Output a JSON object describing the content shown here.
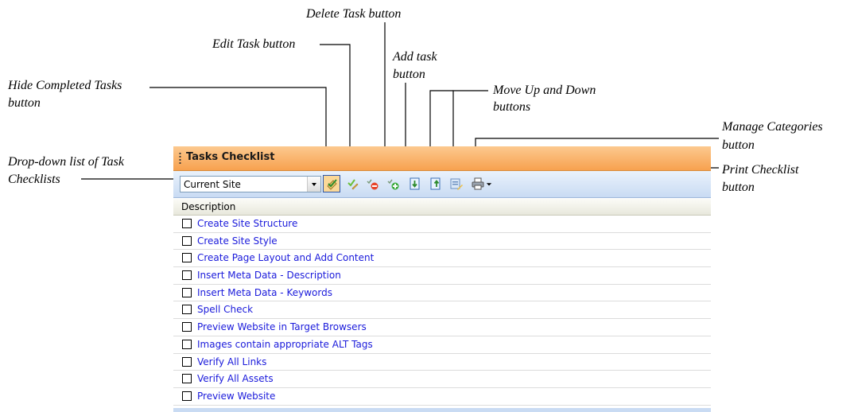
{
  "callouts": {
    "delete": "Delete Task button",
    "edit": "Edit Task button",
    "add_line1": "Add task",
    "add_line2": "button",
    "hide_line1": "Hide Completed Tasks",
    "hide_line2": "button",
    "move_line1": "Move Up and Down",
    "move_line2": "buttons",
    "manage_line1": "Manage Categories",
    "manage_line2": "button",
    "dropdown_line1": "Drop-down list of Task",
    "dropdown_line2": "Checklists",
    "print_line1": "Print Checklist",
    "print_line2": "button"
  },
  "panel": {
    "title": "Tasks Checklist",
    "checklist_select": {
      "value": "Current Site"
    },
    "column_header": "Description",
    "tasks": [
      {
        "label": "Create Site Structure",
        "checked": false
      },
      {
        "label": "Create Site Style",
        "checked": false
      },
      {
        "label": "Create Page Layout and Add Content",
        "checked": false
      },
      {
        "label": "Insert Meta Data - Description",
        "checked": false
      },
      {
        "label": "Insert Meta Data - Keywords",
        "checked": false
      },
      {
        "label": "Spell Check",
        "checked": false
      },
      {
        "label": "Preview Website in Target Browsers",
        "checked": false
      },
      {
        "label": "Images contain appropriate ALT Tags",
        "checked": false
      },
      {
        "label": "Verify All Links",
        "checked": false
      },
      {
        "label": "Verify All Assets",
        "checked": false
      },
      {
        "label": "Preview Website",
        "checked": false
      }
    ]
  },
  "toolbar_icons": [
    "hide-completed-icon",
    "edit-task-icon",
    "delete-task-icon",
    "add-task-icon",
    "move-down-icon",
    "move-up-icon",
    "manage-categories-icon",
    "print-icon"
  ],
  "colors": {
    "title_bar": "#f7a14f",
    "toolbar": "#c9dbf3",
    "task_text": "#1a1adb"
  }
}
